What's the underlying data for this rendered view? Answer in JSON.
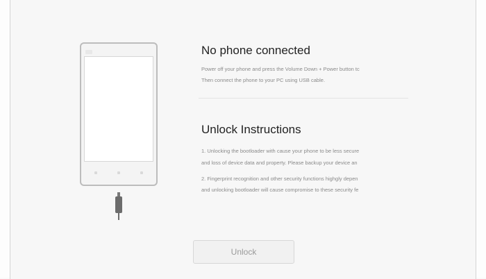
{
  "status": {
    "title": "No phone connected",
    "line1": "Power off your phone and press the Volume Down + Power button tc",
    "line2": "Then connect the phone to your PC using USB cable."
  },
  "instructions": {
    "title": "Unlock Instructions",
    "item1_line1": "1. Unlocking the bootloader with cause your phone to be less secure",
    "item1_line2": "and loss of device data and property. Please backup your device an",
    "item2_line1": "2. Fingerprint recognition and other security functions highgly depen",
    "item2_line2": "and unlocking bootloader will cause compromise to these security fe"
  },
  "actions": {
    "unlock_label": "Unlock"
  },
  "icons": {
    "phone": "phone-illustration-icon",
    "cable": "usb-cable-icon"
  },
  "colors": {
    "background": "#f7f7f7",
    "heading": "#222222",
    "body_text": "#8a8a8a",
    "outline": "#bcbcbc"
  }
}
